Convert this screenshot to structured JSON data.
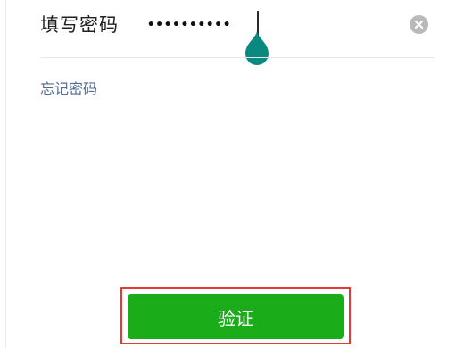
{
  "password_row": {
    "label": "填写密码",
    "value": "••••••••••",
    "clear_icon": "clear-circle-icon"
  },
  "forgot_password": {
    "label": "忘记密码"
  },
  "verify": {
    "label": "验证"
  },
  "colors": {
    "accent": "#1aad19",
    "caret_handle": "#0a8a7e",
    "link": "#576b95",
    "highlight_box": "#e53935"
  }
}
